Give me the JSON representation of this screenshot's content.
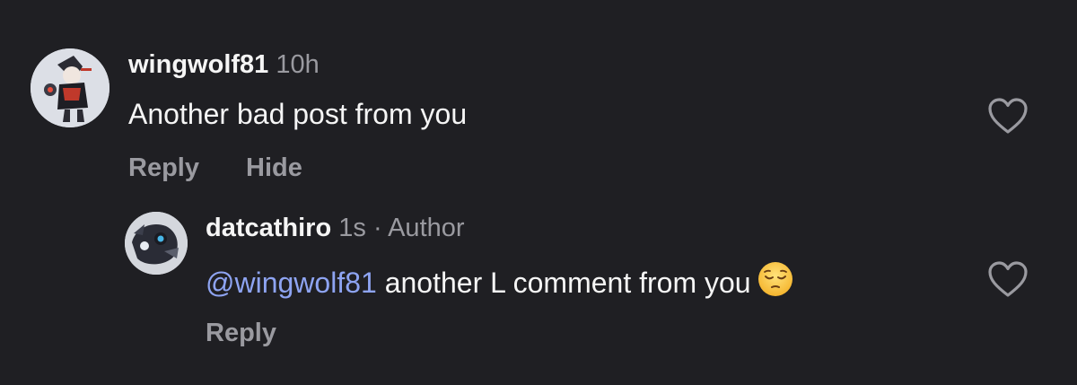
{
  "comments": [
    {
      "username": "wingwolf81",
      "time": "10h",
      "text": "Another bad post from you",
      "actions": {
        "reply": "Reply",
        "hide": "Hide"
      },
      "icon": "heart-outline-icon"
    }
  ],
  "reply": {
    "username": "datcathiro",
    "time": "1s",
    "separator": "·",
    "role": "Author",
    "mention": "@wingwolf81",
    "text": "another L comment from you",
    "emoji": "😔",
    "actions": {
      "reply": "Reply"
    },
    "icon": "heart-outline-icon"
  },
  "colors": {
    "background": "#1f1f23",
    "text": "#f5f5f5",
    "muted": "#9a9aa0",
    "mention": "#8ea4f2"
  }
}
